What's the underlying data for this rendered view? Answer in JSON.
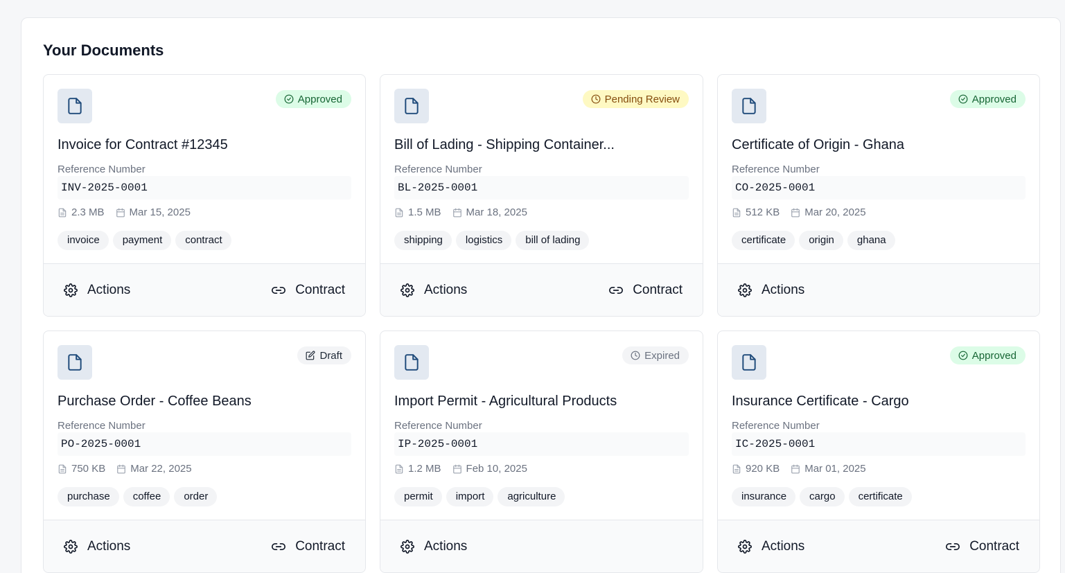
{
  "page": {
    "title": "Your Documents"
  },
  "labels": {
    "reference": "Reference Number",
    "actions": "Actions",
    "contract": "Contract"
  },
  "colors": {
    "approved_bg": "#dcfce7",
    "approved_fg": "#166534",
    "pending_bg": "#fef9c3",
    "pending_fg": "#854d0e",
    "icon_box": "#e3e9f1",
    "icon_stroke": "#1e4a7a"
  },
  "documents": [
    {
      "title": "Invoice for Contract #12345",
      "status": "Approved",
      "status_type": "approved",
      "status_icon": "check-circle-icon",
      "ref": "INV-2025-0001",
      "size": "2.3 MB",
      "date": "Mar 15, 2025",
      "tags": [
        "invoice",
        "payment",
        "contract"
      ],
      "has_contract": true
    },
    {
      "title": "Bill of Lading - Shipping Container...",
      "status": "Pending Review",
      "status_type": "pending",
      "status_icon": "clock-icon",
      "ref": "BL-2025-0001",
      "size": "1.5 MB",
      "date": "Mar 18, 2025",
      "tags": [
        "shipping",
        "logistics",
        "bill of lading"
      ],
      "has_contract": true
    },
    {
      "title": "Certificate of Origin - Ghana",
      "status": "Approved",
      "status_type": "approved",
      "status_icon": "check-circle-icon",
      "ref": "CO-2025-0001",
      "size": "512 KB",
      "date": "Mar 20, 2025",
      "tags": [
        "certificate",
        "origin",
        "ghana"
      ],
      "has_contract": false
    },
    {
      "title": "Purchase Order - Coffee Beans",
      "status": "Draft",
      "status_type": "draft",
      "status_icon": "edit-icon",
      "ref": "PO-2025-0001",
      "size": "750 KB",
      "date": "Mar 22, 2025",
      "tags": [
        "purchase",
        "coffee",
        "order"
      ],
      "has_contract": true
    },
    {
      "title": "Import Permit - Agricultural Products",
      "status": "Expired",
      "status_type": "expired",
      "status_icon": "clock-icon",
      "ref": "IP-2025-0001",
      "size": "1.2 MB",
      "date": "Feb 10, 2025",
      "tags": [
        "permit",
        "import",
        "agriculture"
      ],
      "has_contract": false
    },
    {
      "title": "Insurance Certificate - Cargo",
      "status": "Approved",
      "status_type": "approved",
      "status_icon": "check-circle-icon",
      "ref": "IC-2025-0001",
      "size": "920 KB",
      "date": "Mar 01, 2025",
      "tags": [
        "insurance",
        "cargo",
        "certificate"
      ],
      "has_contract": true
    }
  ]
}
